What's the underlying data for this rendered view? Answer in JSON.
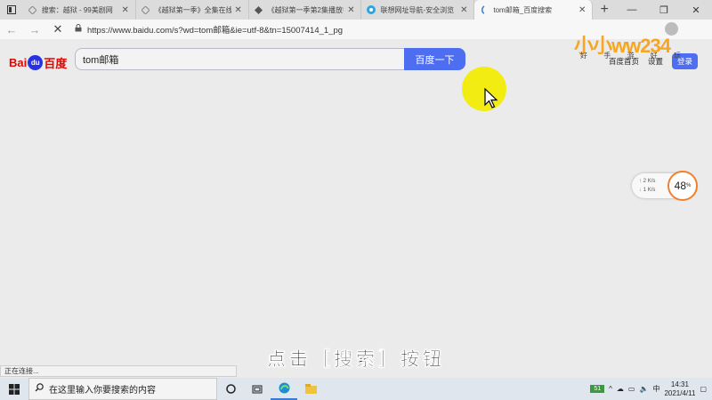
{
  "tabs": [
    {
      "title": "搜索：越狱 - 99美剧网",
      "icon": "diamond-icon",
      "active": false
    },
    {
      "title": "《越狱第一季》全集在线观看",
      "icon": "diamond-icon",
      "active": false
    },
    {
      "title": "《越狱第一季第2集播放中》",
      "icon": "diamond-icon",
      "active": false
    },
    {
      "title": "联想网址导航-安全浏览",
      "icon": "lenovo-icon",
      "active": false
    },
    {
      "title": "tom邮箱_百度搜索",
      "icon": "baidu-icon",
      "active": true
    }
  ],
  "browser": {
    "url": "https://www.baidu.com/s?wd=tom邮箱&ie=utf-8&tn=15007414_1_pg",
    "status": "正在连接..."
  },
  "baidu": {
    "logo_bai": "Bai",
    "logo_du": "百度",
    "logo_paw": "du",
    "query": "tom邮箱",
    "search_button": "百度一下",
    "links": [
      "百度首页",
      "设置"
    ],
    "login_button": "登录"
  },
  "watermark": {
    "text": "小小ww234",
    "sub": "好 手 游 好 玩"
  },
  "speed_widget": {
    "up_rate": "2",
    "up_unit": "K/s",
    "down_rate": "1",
    "down_unit": "K/s",
    "cpu_value": "48",
    "cpu_unit": "%"
  },
  "subtitle": "点击［搜索］按钮",
  "taskbar": {
    "search_placeholder": "在这里输入你要搜索的内容",
    "battery": "51",
    "ime": "中",
    "time": "14:31",
    "date": "2021/4/11"
  },
  "colors": {
    "baidu_blue": "#4e6ef2",
    "baidu_red": "#e10601",
    "cursor_highlight": "#f2ec12"
  }
}
